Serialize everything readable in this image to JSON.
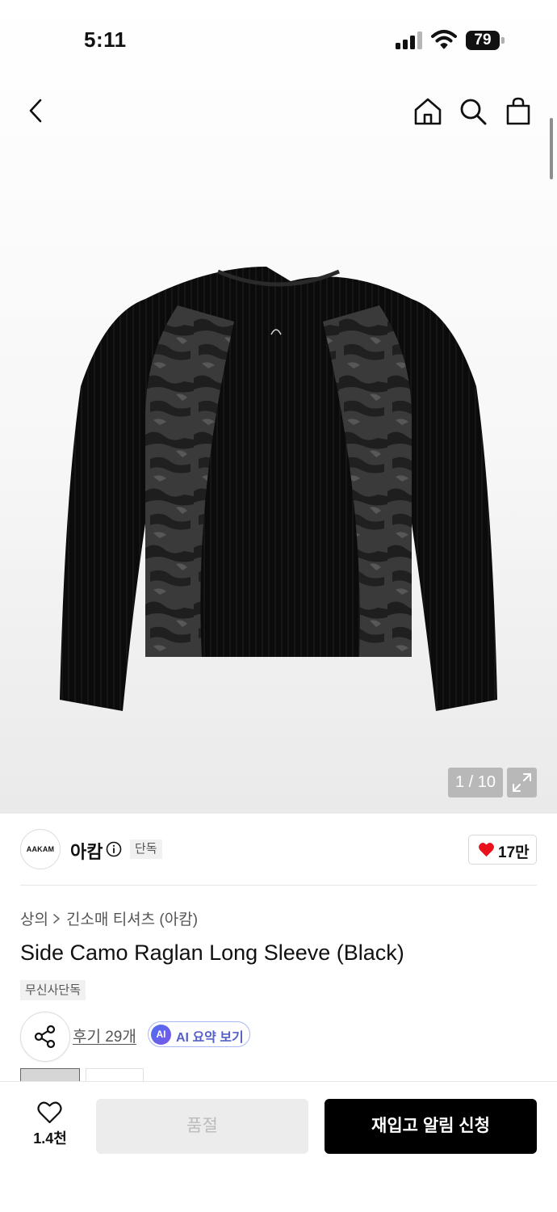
{
  "status_bar": {
    "time": "5:11",
    "battery": "79"
  },
  "navigation": {
    "icons": [
      "back-icon",
      "home-icon",
      "search-icon",
      "shopping-bag-icon"
    ]
  },
  "gallery": {
    "counter": "1 / 10",
    "icons": [
      "expand-icon"
    ]
  },
  "brand": {
    "logo_text": "AAKAM",
    "name": "아캄",
    "tag": "단독",
    "likes": "17만",
    "like_icon_color": "#e8111c"
  },
  "product": {
    "breadcrumb": [
      "상의",
      "긴소매 티셔츠 (아캄)"
    ],
    "title": "Side Camo Raglan Long Sleeve (Black)",
    "tag": "무신사단독",
    "reviews_label": "후기 29개",
    "ai_badge": "AI",
    "ai_label": "AI 요약 보기"
  },
  "bottom_bar": {
    "wishlist_count": "1.4천",
    "soldout_label": "품절",
    "restock_label": "재입고 알림 신청"
  },
  "colors": {
    "primary_button": "#000000",
    "disabled_button": "#ececec",
    "ai_accent": "#5560c9"
  }
}
